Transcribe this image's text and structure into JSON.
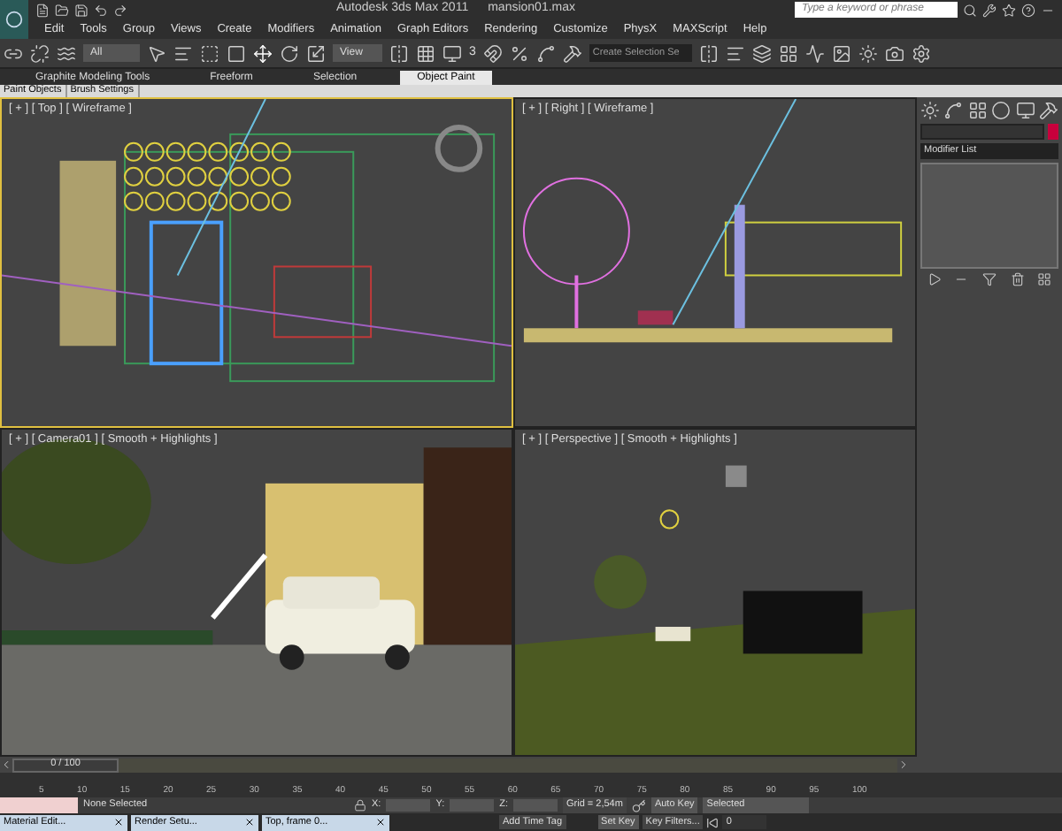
{
  "title_bar": {
    "app_title": "Autodesk 3ds Max  2011",
    "file_name": "mansion01.max",
    "search": {
      "placeholder": "Type a keyword or phrase"
    }
  },
  "menu": [
    "Edit",
    "Tools",
    "Group",
    "Views",
    "Create",
    "Modifiers",
    "Animation",
    "Graph Editors",
    "Rendering",
    "Customize",
    "PhysX",
    "MAXScript",
    "Help"
  ],
  "toolbar": {
    "selection_filter": "All",
    "reference_coord": "View",
    "snap_label": "3",
    "named_selection": "Create Selection Se"
  },
  "ribbon": {
    "tabs": [
      {
        "label": "Graphite Modeling Tools",
        "selected": false
      },
      {
        "label": "Freeform",
        "selected": false
      },
      {
        "label": "Selection",
        "selected": false
      },
      {
        "label": "Object Paint",
        "selected": true
      }
    ],
    "subtabs": [
      "Paint Objects",
      "Brush Settings"
    ]
  },
  "viewports": [
    {
      "kind": "top",
      "label": "[ + ] [ Top ] [ Wireframe ]",
      "selected": true
    },
    {
      "kind": "right",
      "label": "[ + ] [ Right ] [ Wireframe ]",
      "selected": false
    },
    {
      "kind": "camera",
      "label": "[ + ] [ Camera01 ] [ Smooth + Highlights ]",
      "selected": false
    },
    {
      "kind": "perspective",
      "label": "[ + ] [ Perspective ] [ Smooth + Highlights ]",
      "selected": false
    }
  ],
  "command_panel": {
    "modifier_list": "Modifier List"
  },
  "time_slider": {
    "reading": "0 / 100",
    "level": 0,
    "ticks": [
      "5",
      "10",
      "15",
      "20",
      "25",
      "30",
      "35",
      "40",
      "45",
      "50",
      "55",
      "60",
      "65",
      "70",
      "75",
      "80",
      "85",
      "90",
      "95",
      "100"
    ]
  },
  "status": {
    "selection": "None Selected",
    "x_label": "X:",
    "y_label": "Y:",
    "z_label": "Z:",
    "grid": "Grid = 2,54m",
    "time_tag": "Add Time Tag"
  },
  "animation": {
    "auto_key": "Auto Key",
    "key_mode": "Selected",
    "set_key": "Set Key",
    "key_filters": "Key Filters...",
    "frame": "0"
  },
  "taskbar": [
    "Material Edit...",
    "Render Setu...",
    "Top, frame 0..."
  ]
}
